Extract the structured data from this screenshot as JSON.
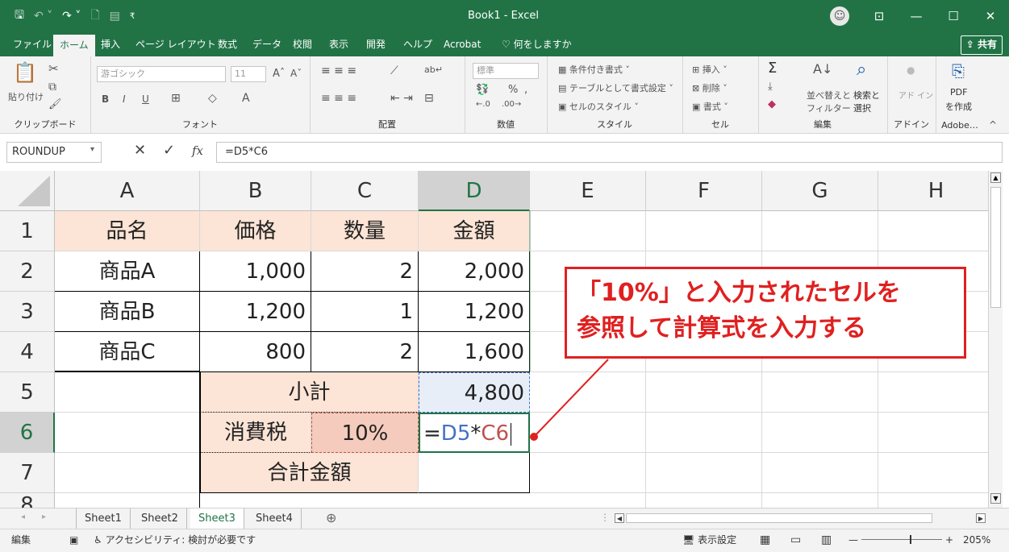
{
  "window": {
    "title": "Book1  -  Excel",
    "controls": {
      "ribbon_display": "⊡",
      "minimize": "—",
      "maximize": "☐",
      "close": "✕"
    }
  },
  "qat": {
    "save": "🖫",
    "undo": "↶ ˅",
    "redo": "↷ ˅",
    "new": "🗋",
    "form": "▤",
    "more": "₹"
  },
  "menu": {
    "tabs": [
      "ファイル",
      "ホーム",
      "挿入",
      "ページ レイアウト",
      "数式",
      "データ",
      "校閲",
      "表示",
      "開発",
      "ヘルプ",
      "Acrobat"
    ],
    "search": "何をしますか",
    "share": "共有"
  },
  "ribbon": {
    "clipboard": {
      "label": "クリップボード",
      "paste": "貼り付け"
    },
    "font": {
      "label": "フォント",
      "font_name": "游ゴシック",
      "font_size": "11",
      "bold": "B",
      "italic": "I",
      "underline": "U"
    },
    "alignment": {
      "label": "配置"
    },
    "number": {
      "label": "数値",
      "format": "標準",
      "percent": "%"
    },
    "styles": {
      "label": "スタイル",
      "cond": "条件付き書式",
      "table": "テーブルとして書式設定",
      "cellstyle": "セルのスタイル"
    },
    "cells": {
      "label": "セル",
      "insert": "挿入",
      "delete": "削除",
      "format": "書式"
    },
    "editing": {
      "label": "編集",
      "sort": "並べ替えと",
      "filter": "フィルター",
      "find": "検索と",
      "select": "選択"
    },
    "addin": {
      "label": "アドイン",
      "name": "アド イン"
    },
    "adobe": {
      "label": "Adobe…",
      "pdf": "PDF",
      "create": "を作成"
    }
  },
  "formula_bar": {
    "name_box": "ROUNDUP",
    "fx": "fx",
    "cancel": "✕",
    "enter": "✓",
    "formula": "=D5*C6"
  },
  "columns": [
    "A",
    "B",
    "C",
    "D",
    "E",
    "F",
    "G",
    "H"
  ],
  "rows": [
    "1",
    "2",
    "3",
    "4",
    "5",
    "6",
    "7",
    "8"
  ],
  "table": {
    "headers": [
      "品名",
      "価格",
      "数量",
      "金額"
    ],
    "items": [
      {
        "name": "商品A",
        "price": "1,000",
        "qty": "2",
        "amount": "2,000"
      },
      {
        "name": "商品B",
        "price": "1,200",
        "qty": "1",
        "amount": "1,200"
      },
      {
        "name": "商品C",
        "price": "800",
        "qty": "2",
        "amount": "1,600"
      }
    ],
    "subtotal_label": "小計",
    "subtotal_value": "4,800",
    "tax_label": "消費税",
    "tax_rate": "10%",
    "edit": {
      "eq": "=",
      "ref1": "D5",
      "op": "*",
      "ref2": "C6"
    },
    "total_label": "合計金額"
  },
  "callout": {
    "line1": "「10%」と入力されたセルを",
    "line2": "参照して計算式を入力する"
  },
  "sheets": [
    "Sheet1",
    "Sheet2",
    "Sheet3",
    "Sheet4"
  ],
  "active_sheet": "Sheet3",
  "status": {
    "mode": "編集",
    "accessibility": "アクセシビリティ: 検討が必要です",
    "display_settings": "表示設定",
    "zoom": "205%"
  },
  "colors": {
    "excel_green": "#217346",
    "peach": "#fce4d6",
    "ref_blue": "#4472c4",
    "ref_red": "#c0504d",
    "callout_red": "#e02020"
  }
}
